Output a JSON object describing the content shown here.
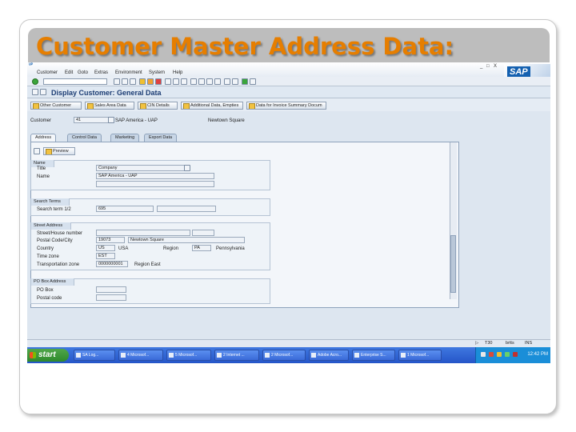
{
  "slide": {
    "title": "Customer Master Address Data:"
  },
  "sap": {
    "window_icon": "ᵁᴾ",
    "menu": [
      "Customer",
      "Edit",
      "Goto",
      "Extras",
      "Environment",
      "System",
      "Help"
    ],
    "window_controls": [
      "_",
      "□",
      "X"
    ],
    "logo": "SAP",
    "screen_title": "Display Customer: General Data",
    "app_buttons": [
      "Other Customer",
      "Sales Area Data",
      "CIN Details",
      "Additional Data, Empties",
      "Data for Invoice Summary Docum"
    ],
    "customer": {
      "label": "Customer",
      "value": "41",
      "name": "SAP America - UAP",
      "city": "Newtown Square"
    },
    "tabs": [
      "Address",
      "Control Data",
      "Marketing",
      "Export Data"
    ],
    "preview_label": "Preview",
    "name_group": {
      "title": "Name",
      "title_label": "Title",
      "title_value": "Company",
      "name_label": "Name",
      "name_value": "SAP America - UAP"
    },
    "search_group": {
      "title": "Search Terms",
      "label": "Search term 1/2",
      "value": "695"
    },
    "street_group": {
      "title": "Street Address",
      "street_label": "Street/House number",
      "postal_label": "Postal Code/City",
      "postal_value": "19073",
      "city_value": "Newtown Square",
      "country_label": "Country",
      "country_value": "US",
      "country_name": "USA",
      "region_label": "Region",
      "region_value": "PA",
      "region_name": "Pennsylvania",
      "timezone_label": "Time zone",
      "timezone_value": "EST",
      "transport_label": "Transportation zone",
      "transport_value": "0000000001",
      "transport_name": "Region East"
    },
    "po_group": {
      "title": "PO Box Address",
      "pobox_label": "PO Box",
      "postal_label": "Postal code"
    },
    "status": {
      "system": "T30",
      "client": "brtts",
      "mode": "INS"
    },
    "taskbar": {
      "start": "start",
      "tasks": [
        "SA Log...",
        "4 Microsof...",
        "5 Microsof...",
        "2 Internet ...",
        "2 Microsof...",
        "Adobe Acro...",
        "Enterprise S...",
        "1 Microsof..."
      ],
      "clock": "12:42 PM"
    }
  }
}
